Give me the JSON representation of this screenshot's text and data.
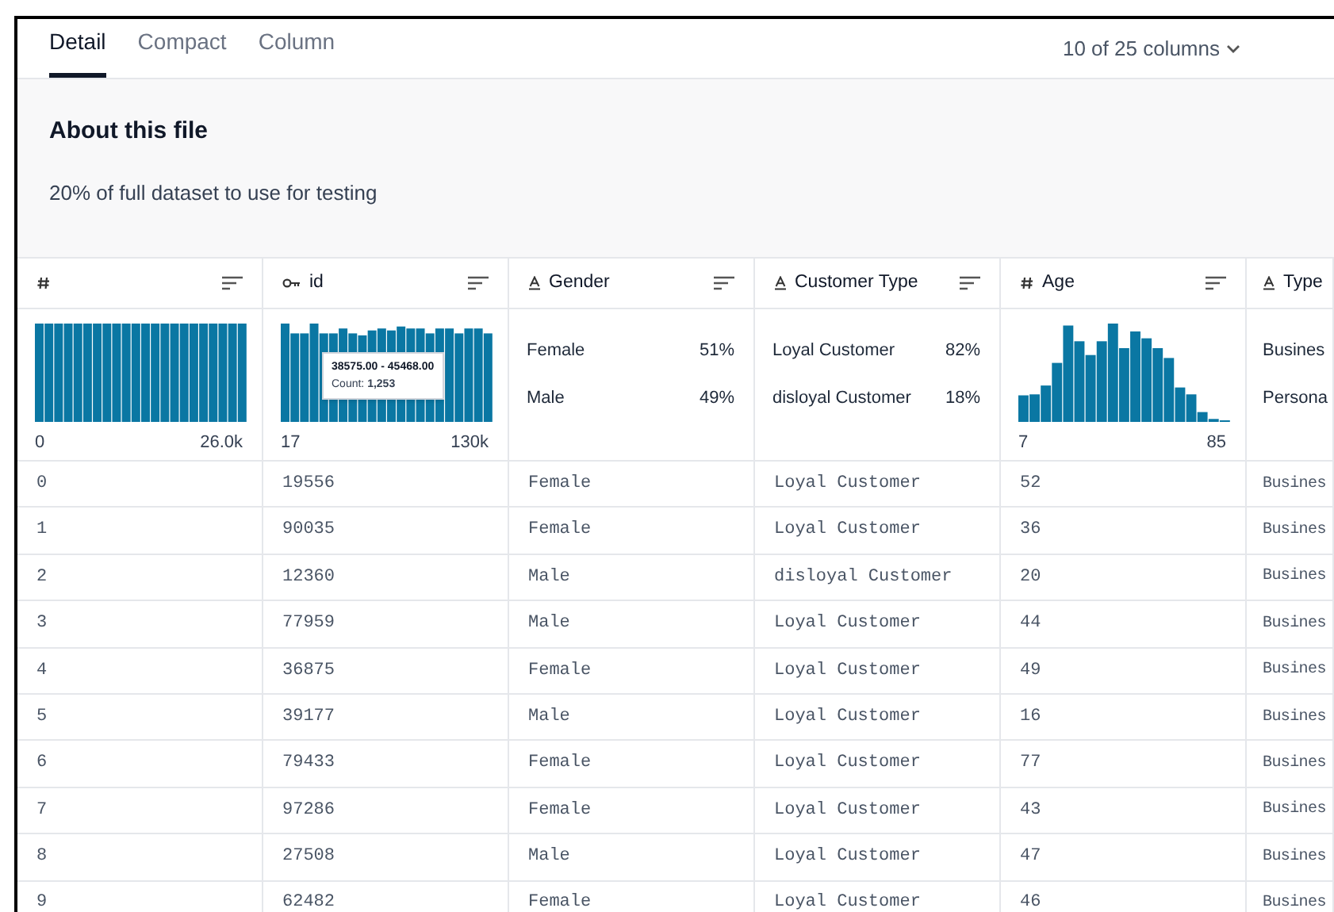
{
  "tabs": [
    {
      "label": "Detail",
      "selected": true
    },
    {
      "label": "Compact",
      "selected": false
    },
    {
      "label": "Column",
      "selected": false
    }
  ],
  "column_count": "10 of 25 columns",
  "about": {
    "title": "About this file",
    "description": "20% of full dataset to use for testing"
  },
  "columns": [
    {
      "kind": "numeric",
      "sortable": true,
      "summary": {
        "kind": "histogram",
        "min": "0",
        "max": "26.0k"
      }
    },
    {
      "name": "id",
      "kind": "key",
      "sortable": true,
      "summary": {
        "kind": "histogram",
        "min": "17",
        "max": "130k",
        "tooltip": {
          "range": "38575.00 - 45468.00",
          "count": "Count: **1,253**"
        }
      }
    },
    {
      "name": "Gender",
      "kind": "text",
      "sortable": true,
      "summary": {
        "kind": "categories",
        "items": [
          {
            "label": "Female",
            "share": "51%"
          },
          {
            "label": "Male",
            "share": "49%"
          }
        ]
      }
    },
    {
      "name": "Customer Type",
      "kind": "text",
      "sortable": true,
      "summary": {
        "kind": "categories",
        "items": [
          {
            "label": "Loyal Customer",
            "share": "82%"
          },
          {
            "label": "disloyal Customer",
            "share": "18%"
          }
        ]
      }
    },
    {
      "name": "Age",
      "kind": "numeric",
      "sortable": true,
      "summary": {
        "kind": "histogram",
        "min": "7",
        "max": "85"
      }
    },
    {
      "name": "Type",
      "kind": "text",
      "summary": {
        "kind": "categories",
        "items": [
          {
            "label": "Busines"
          },
          {
            "label": "Persona"
          }
        ]
      }
    }
  ],
  "rows": [
    [
      "0",
      "19556",
      "Female",
      "Loyal Customer",
      "52",
      "Busines"
    ],
    [
      "1",
      "90035",
      "Female",
      "Loyal Customer",
      "36",
      "Busines"
    ],
    [
      "2",
      "12360",
      "Male",
      "disloyal Customer",
      "20",
      "Busines"
    ],
    [
      "3",
      "77959",
      "Male",
      "Loyal Customer",
      "44",
      "Busines"
    ],
    [
      "4",
      "36875",
      "Female",
      "Loyal Customer",
      "49",
      "Busines"
    ],
    [
      "5",
      "39177",
      "Male",
      "Loyal Customer",
      "16",
      "Busines"
    ],
    [
      "6",
      "79433",
      "Female",
      "Loyal Customer",
      "77",
      "Busines"
    ],
    [
      "7",
      "97286",
      "Female",
      "Loyal Customer",
      "43",
      "Busines"
    ],
    [
      "8",
      "27508",
      "Male",
      "Loyal Customer",
      "47",
      "Busines"
    ],
    [
      "9",
      "62482",
      "Female",
      "Loyal Customer",
      "46",
      "Busines"
    ]
  ]
}
